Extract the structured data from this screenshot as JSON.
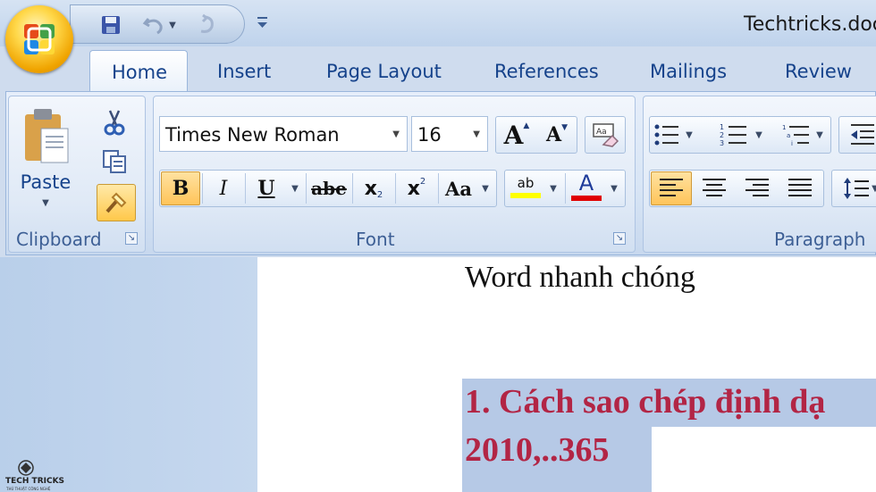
{
  "window": {
    "title": "Techtricks.doc"
  },
  "tabs": [
    "Home",
    "Insert",
    "Page Layout",
    "References",
    "Mailings",
    "Review"
  ],
  "clipboard": {
    "paste_label": "Paste",
    "group_label": "Clipboard"
  },
  "font": {
    "family": "Times New Roman",
    "size": "16",
    "group_label": "Font",
    "grow_glyph": "A",
    "shrink_glyph": "A",
    "bold": "B",
    "italic": "I",
    "underline": "U",
    "strikethrough": "abe",
    "subscript": "x",
    "superscript": "x",
    "change_case": "Aa",
    "highlight_glyph": "ab",
    "font_color_glyph": "A",
    "highlight_color": "#ffff00",
    "font_color": "#e00000"
  },
  "paragraph": {
    "group_label": "Paragraph"
  },
  "document": {
    "line1": "Word nhanh chóng",
    "heading_line1": "1. Cách sao chép định dạ",
    "heading_line2": "2010,..365",
    "heading_color": "#b22545"
  },
  "watermark": {
    "title": "TECH TRICKS",
    "subtitle": "THỦ THUẬT CÔNG NGHỆ"
  },
  "colors": {
    "tab_text": "#15428b",
    "ribbon_bg": "#d8e5f5",
    "active_button": "#ffd676"
  }
}
